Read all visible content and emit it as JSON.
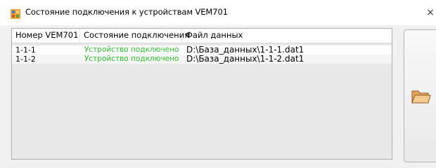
{
  "window": {
    "title": "Состояние подключения к устройствам VEM701",
    "close_glyph": "×",
    "icon": "app-icon"
  },
  "table": {
    "columns": [
      "Номер VEM701",
      "Состояние подключения",
      "Файл данных"
    ],
    "rows": [
      [
        "1-1-1",
        "Устройство подключено",
        "D:\\База_данных\\1-1-1.dat1"
      ],
      [
        "1-1-2",
        "Устройство подключено",
        "D:\\База_данных\\1-1-2.dat1"
      ]
    ]
  },
  "folder_button": {
    "icon": "folder-open-icon"
  },
  "colors": {
    "status_connected": "#2dbe2d",
    "window_bg": "#f0f0f0",
    "folder": "#e8a25a"
  }
}
